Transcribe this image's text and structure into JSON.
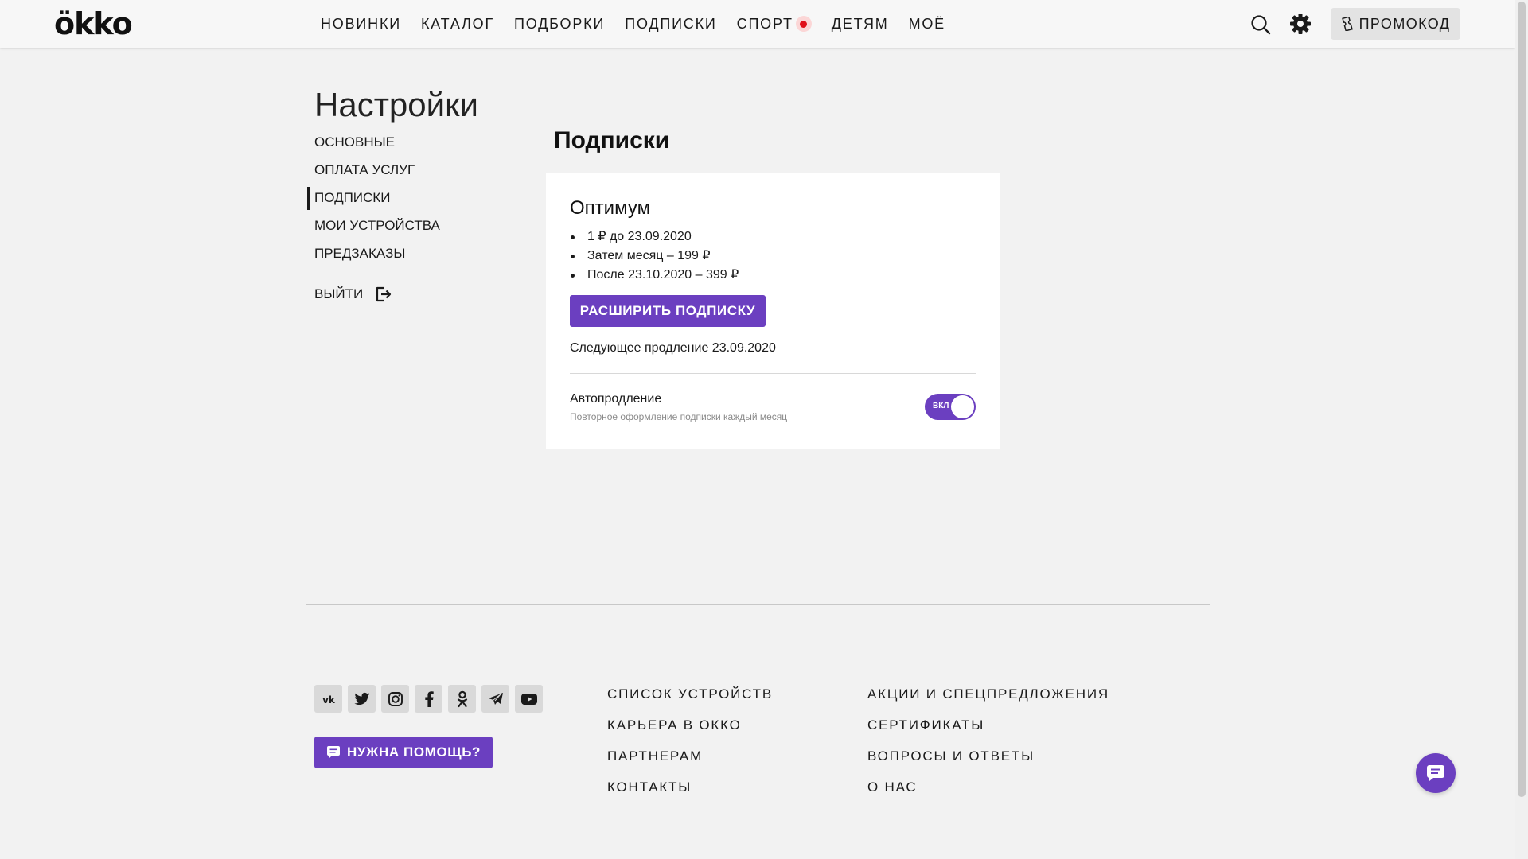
{
  "header": {
    "logo": "ökko",
    "nav": [
      {
        "label": "НОВИНКИ"
      },
      {
        "label": "КАТАЛОГ"
      },
      {
        "label": "ПОДБОРКИ"
      },
      {
        "label": "ПОДПИСКИ"
      },
      {
        "label": "СПОРТ",
        "live": true
      },
      {
        "label": "ДЕТЯМ"
      },
      {
        "label": "МОЁ"
      }
    ],
    "search_icon": "search-icon",
    "settings_icon": "gear-icon",
    "promo_label": "ПРОМОКОД"
  },
  "settings": {
    "title": "Настройки",
    "menu": [
      {
        "label": "ОСНОВНЫЕ"
      },
      {
        "label": "ОПЛАТА УСЛУГ"
      },
      {
        "label": "ПОДПИСКИ",
        "active": true
      },
      {
        "label": "МОИ УСТРОЙСТВА"
      },
      {
        "label": "ПРЕДЗАКАЗЫ"
      }
    ],
    "logout_label": "ВЫЙТИ"
  },
  "subscriptions": {
    "title": "Подписки",
    "plan": {
      "name": "Оптимум",
      "terms": [
        "1 ₽ до 23.09.2020",
        "Затем месяц – 199 ₽",
        "После 23.10.2020 – 399 ₽"
      ],
      "upgrade_label": "РАСШИРИТЬ ПОДПИСКУ",
      "next_renewal": "Следующее продление 23.09.2020",
      "autorenew": {
        "label": "Автопродление",
        "description": "Повторное оформление подписки каждый месяц",
        "toggle_text": "ВКЛ",
        "enabled": true
      }
    }
  },
  "footer": {
    "socials": [
      "vk-icon",
      "twitter-icon",
      "instagram-icon",
      "facebook-icon",
      "odnoklassniki-icon",
      "telegram-icon",
      "youtube-icon"
    ],
    "help_label": "НУЖНА ПОМОЩЬ?",
    "col1": [
      {
        "label": "СПИСОК УСТРОЙСТВ"
      },
      {
        "label": "КАРЬЕРА В ОККО"
      },
      {
        "label": "ПАРТНЕРАМ"
      },
      {
        "label": "КОНТАКТЫ"
      }
    ],
    "col2": [
      {
        "label": "АКЦИИ И СПЕЦПРЕДЛОЖЕНИЯ"
      },
      {
        "label": "СЕРТИФИКАТЫ"
      },
      {
        "label": "ВОПРОСЫ И ОТВЕТЫ"
      },
      {
        "label": "О НАС"
      }
    ]
  },
  "colors": {
    "accent": "#6b3fc0",
    "live_red": "#e0101a",
    "background": "#f2f2f2"
  }
}
